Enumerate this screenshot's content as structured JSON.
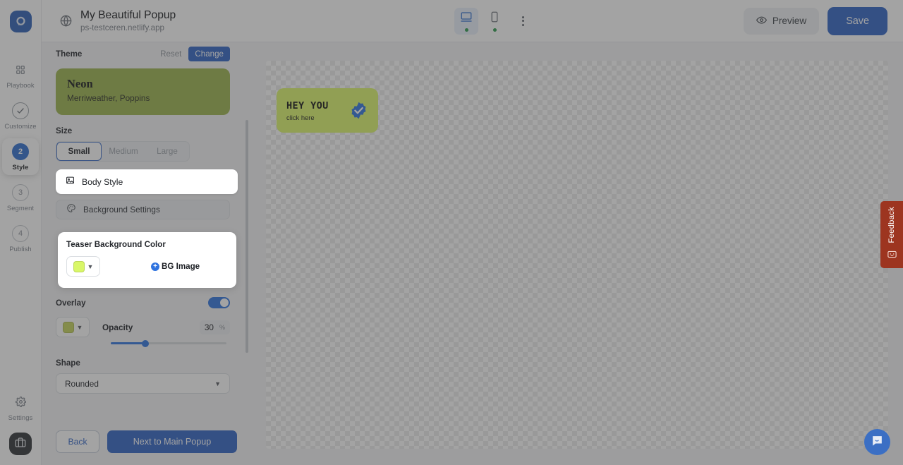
{
  "brand": {
    "logo_icon": "popupsmart-logo-icon",
    "accent": "#2f62c4"
  },
  "sidebar": {
    "steps": [
      {
        "label": "Playbook",
        "marker": "grid-icon",
        "state": "default"
      },
      {
        "label": "Customize",
        "marker": "check-circle-icon",
        "state": "done"
      },
      {
        "label": "Style",
        "marker": "2",
        "state": "active"
      },
      {
        "label": "Segment",
        "marker": "3",
        "state": "default"
      },
      {
        "label": "Publish",
        "marker": "4",
        "state": "default"
      }
    ],
    "settings_label": "Settings",
    "settings_icon": "gear-icon",
    "briefcase_icon": "briefcase-icon"
  },
  "topbar": {
    "globe_icon": "globe-icon",
    "title": "My Beautiful Popup",
    "url": "ps-testceren.netlify.app",
    "devices": [
      {
        "name": "desktop",
        "icon": "desktop-icon",
        "active": true,
        "status": "online"
      },
      {
        "name": "mobile",
        "icon": "mobile-icon",
        "active": false,
        "status": "online"
      }
    ],
    "more_icon": "kebab-menu-icon",
    "preview_label": "Preview",
    "preview_icon": "eye-icon",
    "save_label": "Save"
  },
  "panel": {
    "theme": {
      "section_label": "Theme",
      "reset_label": "Reset",
      "change_label": "Change",
      "name": "Neon",
      "fonts": "Merriweather, Poppins",
      "color": "#9cb34c"
    },
    "size": {
      "label": "Size",
      "options": [
        "Small",
        "Medium",
        "Large"
      ],
      "selected": "Small"
    },
    "body_style": {
      "label": "Body Style",
      "icon": "image-icon"
    },
    "background_settings": {
      "label": "Background Settings",
      "icon": "palette-icon"
    },
    "teaser_background": {
      "label": "Teaser Background Color",
      "swatch_color": "#d9f768",
      "chevron_icon": "chevron-down-icon",
      "bg_image_label": "BG Image",
      "bg_image_icon": "plus-circle-icon"
    },
    "overlay": {
      "label": "Overlay",
      "enabled": true,
      "swatch_color": "#c5d45a",
      "opacity_label": "Opacity",
      "opacity_value": "30",
      "opacity_unit": "%"
    },
    "shape": {
      "label": "Shape",
      "selected": "Rounded",
      "chevron_icon": "chevron-down-icon"
    },
    "footer": {
      "back_label": "Back",
      "next_label": "Next to Main Popup"
    }
  },
  "canvas": {
    "teaser": {
      "headline": "HEY YOU",
      "subtext": "click here",
      "background": "#ddf86b",
      "badge_icon": "verified-check-badge-icon"
    }
  },
  "feedback": {
    "label": "Feedback",
    "icon": "robot-face-icon",
    "color": "#9d3520"
  },
  "chat": {
    "icon": "chat-bubble-icon"
  }
}
